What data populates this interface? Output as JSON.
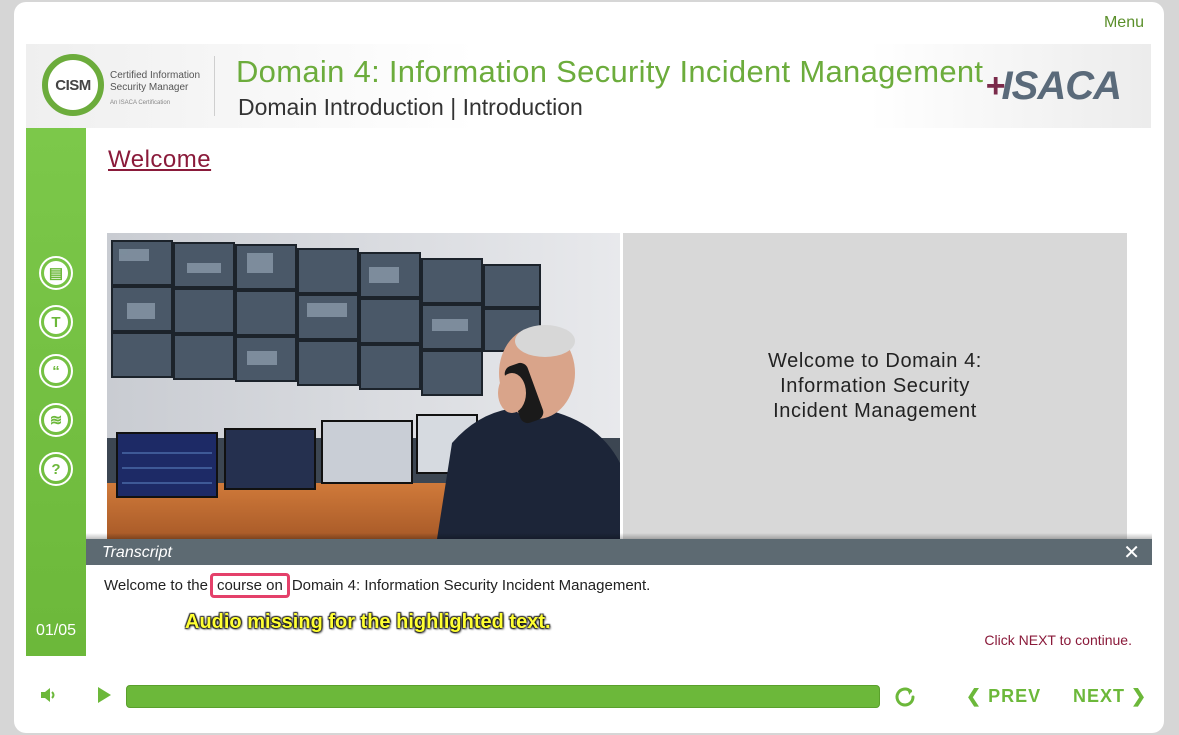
{
  "header": {
    "menu_label": "Menu",
    "title": "Domain 4: Information Security Incident Management",
    "subtitle": "Domain Introduction | Introduction",
    "cism_logo_text": "CISM",
    "cism_tagline_line1": "Certified Information",
    "cism_tagline_line2": "Security Manager",
    "cism_subtagline": "An ISACA Certification",
    "isaca_logo_text": "ISACA"
  },
  "sidebar": {
    "icons": [
      {
        "name": "notes-icon",
        "glyph": "▤"
      },
      {
        "name": "transcript-icon",
        "glyph": "T"
      },
      {
        "name": "quote-icon",
        "glyph": "“"
      },
      {
        "name": "layers-icon",
        "glyph": "≋"
      },
      {
        "name": "help-icon",
        "glyph": "?"
      }
    ],
    "page_counter": "01/05"
  },
  "main": {
    "heading": "Welcome",
    "panel_text": "Welcome to Domain 4:\nInformation Security\nIncident Management"
  },
  "transcript": {
    "title": "Transcript",
    "close_glyph": "✕",
    "text_before": "Welcome to the",
    "text_highlight": "course on",
    "text_after": "Domain 4: Information Security Incident Management.",
    "audio_note": "Audio missing for the highlighted text.",
    "click_next": "Click NEXT to continue."
  },
  "controls": {
    "progress_fraction": 1.0,
    "prev_label": "PREV",
    "next_label": "NEXT"
  },
  "colors": {
    "brand_green": "#6cb83a",
    "heading_maroon": "#8a1a3a",
    "highlight_pink": "#e4406a",
    "transcript_bar": "#5d6a72"
  }
}
